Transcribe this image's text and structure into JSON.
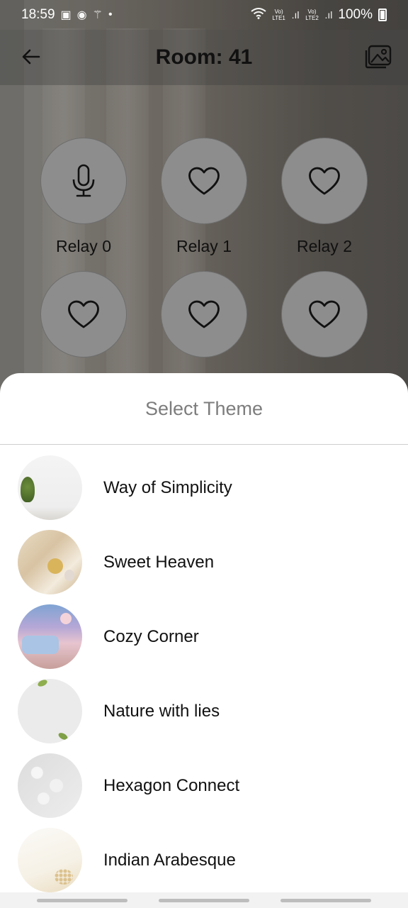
{
  "status_bar": {
    "time": "18:59",
    "left_icons": [
      "cb-icon",
      "messenger-icon",
      "magic-wand-icon",
      "dot-icon"
    ],
    "right_icons": [
      "wifi-icon",
      "volte1-icon",
      "signal1-icon",
      "volte2-icon",
      "signal2-icon"
    ],
    "volte1": "Vo) LTE1",
    "volte2": "Vo) LTE2",
    "battery_text": "100%"
  },
  "app_bar": {
    "title": "Room: 41",
    "back_icon": "back-arrow-icon",
    "action_icon": "image-gallery-icon"
  },
  "relays": [
    {
      "label": "Relay 0",
      "icon": "microphone-icon"
    },
    {
      "label": "Relay 1",
      "icon": "heart-icon"
    },
    {
      "label": "Relay 2",
      "icon": "heart-icon"
    },
    {
      "label": "",
      "icon": "heart-icon"
    },
    {
      "label": "",
      "icon": "heart-icon"
    },
    {
      "label": "",
      "icon": "heart-icon"
    }
  ],
  "sheet": {
    "title": "Select Theme",
    "themes": [
      {
        "name": "Way of Simplicity"
      },
      {
        "name": "Sweet Heaven"
      },
      {
        "name": "Cozy Corner"
      },
      {
        "name": "Nature with lies"
      },
      {
        "name": "Hexagon Connect"
      },
      {
        "name": "Indian Arabesque"
      }
    ]
  },
  "colors": {
    "sheet_bg": "#ffffff",
    "title_gray": "#7d7d7d",
    "relay_circle": "#8d8d8d"
  }
}
